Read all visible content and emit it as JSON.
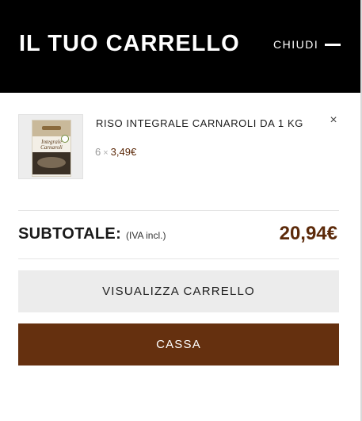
{
  "header": {
    "title": "IL TUO CARRELLO",
    "close_label": "CHIUDI"
  },
  "cart": {
    "items": [
      {
        "name": "RISO INTEGRALE CARNAROLI DA 1 KG",
        "quantity": "6",
        "times": "×",
        "unit_price": "3,49€",
        "remove": "×",
        "package_text": "Integrale Carnaroli"
      }
    ]
  },
  "summary": {
    "subtotal_label": "SUBTOTALE:",
    "tax_note": "(IVA incl.)",
    "subtotal_value": "20,94€"
  },
  "actions": {
    "view_cart": "VISUALIZZA CARRELLO",
    "checkout": "CASSA"
  },
  "colors": {
    "header_bg": "#000000",
    "accent": "#65300f",
    "price": "#5c2a0a",
    "secondary_button_bg": "#ececec"
  }
}
